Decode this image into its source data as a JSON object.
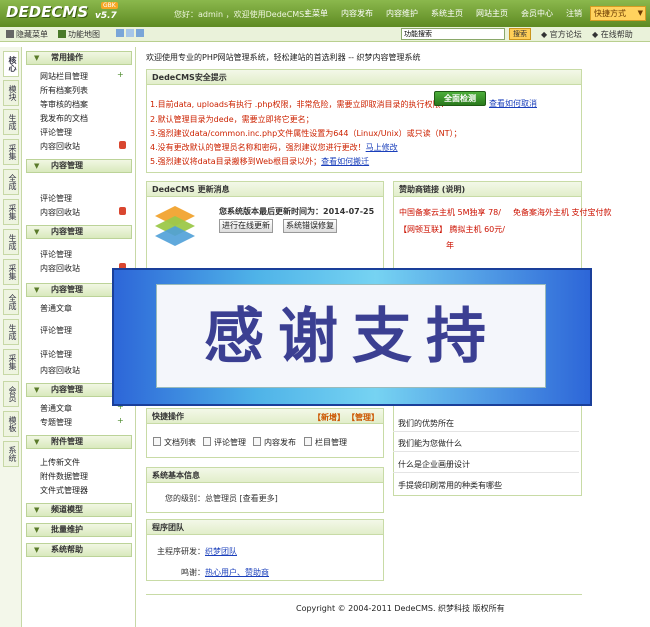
{
  "topbar": {
    "logo": "DEDECMS",
    "version": "v5.7",
    "badge": "GBK",
    "welcome": "您好：admin ，欢迎使用DedeCMS！",
    "nav": [
      "主菜单",
      "内容发布",
      "内容维护",
      "系统主页",
      "网站主页",
      "会员中心",
      "注销"
    ],
    "quick": "快捷方式"
  },
  "bar2": {
    "hide_menu": "隐藏菜单",
    "feature_map": "功能地图",
    "search_value": "功能搜索",
    "search_btn": "搜索",
    "forum": "官方论坛",
    "help": "在线帮助"
  },
  "vtabs": [
    "核心",
    "模块",
    "生成",
    "采集",
    "会员",
    "模板",
    "系统"
  ],
  "vtabs_faint": [
    "全成",
    "采集",
    "生成",
    "采集",
    "全成",
    "生成",
    "采集"
  ],
  "menu": {
    "sec1": "常用操作",
    "sec1_items": [
      "网站栏目管理",
      "所有档案列表",
      "等审核的档案",
      "我发布的文档",
      "评论管理",
      "内容回收站"
    ],
    "sec2": "内容管理",
    "sec2_items": [
      "评论管理",
      "内容回收站"
    ],
    "sec3": "内容管理",
    "sec3_items": [
      "评论管理",
      "内容回收站"
    ],
    "sec4": "内容管理",
    "sec4_items": [
      "普通文章",
      "评论管理",
      "评论管理",
      "内容回收站"
    ],
    "sec5": "内容管理",
    "sec5_items": [
      "普通文章",
      "专题管理"
    ],
    "sec6": "附件管理",
    "sec6_items": [
      "上传新文件",
      "附件数据管理",
      "文件式管理器"
    ],
    "sec7": "频道模型",
    "sec8": "批量维护",
    "sec9": "系统帮助"
  },
  "main": {
    "intro": "欢迎使用专业的PHP网站管理系统，轻松建站的首选利器 -- 织梦内容管理系统",
    "security_title": "DedeCMS安全提示",
    "sec_lines": [
      "1.目前data, uploads有执行 .php权限，非常危险，需要立即取消目录的执行权限！",
      "2.默认管理目录为dede，需要立即将它更名；",
      "3.强烈建议data/common.inc.php文件属性设置为644（Linux/Unix）或只读（NT）；",
      "4.没有更改默认的管理员名称和密码，强烈建议您进行更改！",
      "5.强烈建议将data目录搬移到Web根目录以外；"
    ],
    "sec_link_4": "马上修改",
    "sec_link_5": "查看如何搬迁",
    "check_btn": "全面检测",
    "check_link": "查看如何取消",
    "update_title": "DedeCMS 更新消息",
    "update_text": "您系统版本最后更新时间为：2014-07-25",
    "update_btn1": "进行在线更新",
    "update_btn2": "系统错误修复",
    "sponsor_title": "赞助商链接 (说明)",
    "ad1": "中国备案云主机 5M独享 78/",
    "ad2": "免备案海外主机 支付宝付款",
    "ad3": "【网顿互联】 腾拟主机 60元/",
    "ad3b": "年",
    "thanks": "感谢支持",
    "quick_title": "快捷操作",
    "quick_add": "【新增】",
    "quick_manage": "【管理】",
    "quick_items": [
      "文档列表",
      "评论管理",
      "内容发布",
      "栏目管理"
    ],
    "list_items": [
      "我们的优势所在",
      "我们能为您做什么",
      "什么是企业画册设计",
      "手提袋印刷常用的种类有哪些"
    ],
    "sysinfo_title": "系统基本信息",
    "level_label": "您的级别：",
    "level_value": "总管理员 [查看更多]",
    "team_title": "程序团队",
    "dev_label": "主程序研发：",
    "dev_value": "织梦团队",
    "thanks_label": "鸣谢：",
    "thanks_value": "热心用户、赞助商",
    "copyright": "Copyright © 2004-2011 DedeCMS. 织梦科技 版权所有"
  }
}
